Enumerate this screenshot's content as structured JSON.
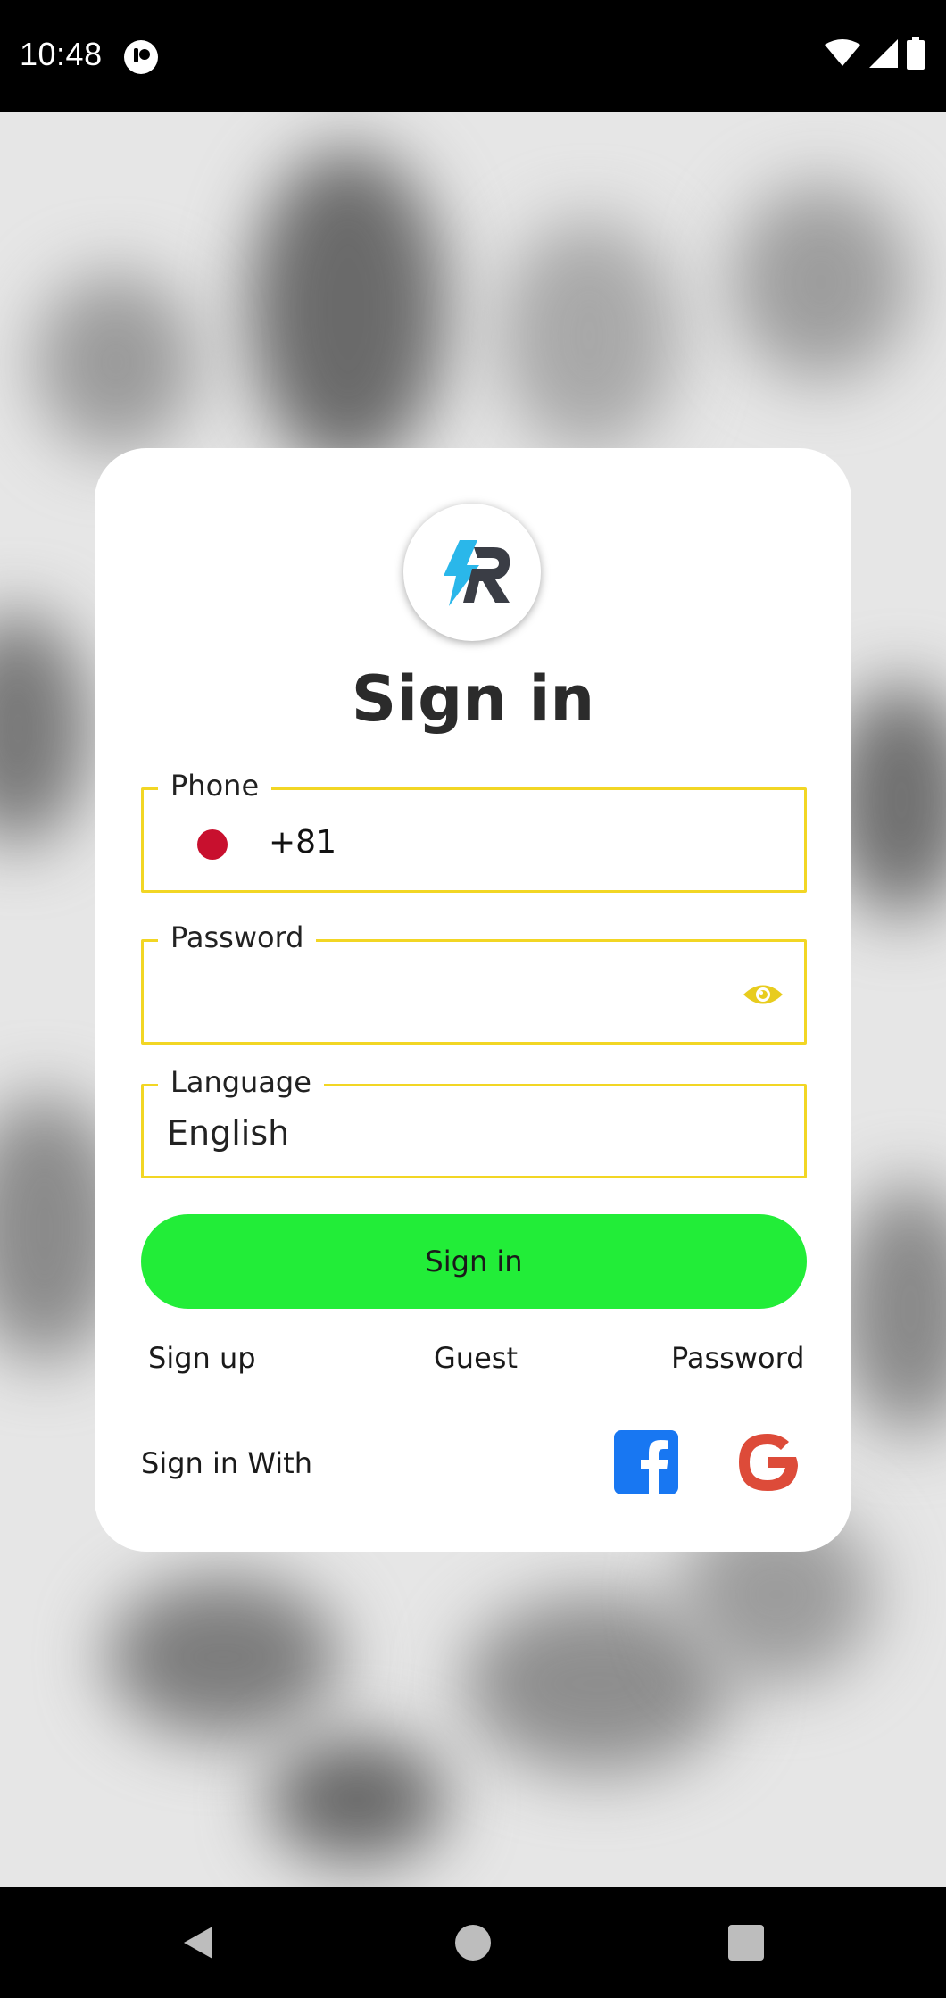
{
  "status_bar": {
    "time": "10:48",
    "app_icon": "app-notification-icon",
    "icons": [
      "wifi-icon",
      "signal-icon",
      "battery-icon"
    ]
  },
  "card": {
    "logo": "app-logo-icon",
    "title": "Sign in",
    "phone": {
      "label": "Phone",
      "country_flag": "japan-flag-icon",
      "value": "+81"
    },
    "password": {
      "label": "Password",
      "value": "",
      "toggle_icon": "eye-icon"
    },
    "language": {
      "label": "Language",
      "value": "English"
    },
    "signin_button": "Sign in",
    "links": {
      "signup": "Sign up",
      "guest": "Guest",
      "password": "Password"
    },
    "social": {
      "label": "Sign in With",
      "facebook_icon": "facebook-icon",
      "google_icon": "google-icon"
    }
  },
  "colors": {
    "field_border": "#f2d624",
    "primary_button": "#22ed38",
    "flag_red": "#c8102e",
    "facebook_blue": "#1877f2",
    "google_red": "#dd4b39"
  },
  "nav_bar": {
    "icons": [
      "back-icon",
      "home-icon",
      "recents-icon"
    ]
  }
}
